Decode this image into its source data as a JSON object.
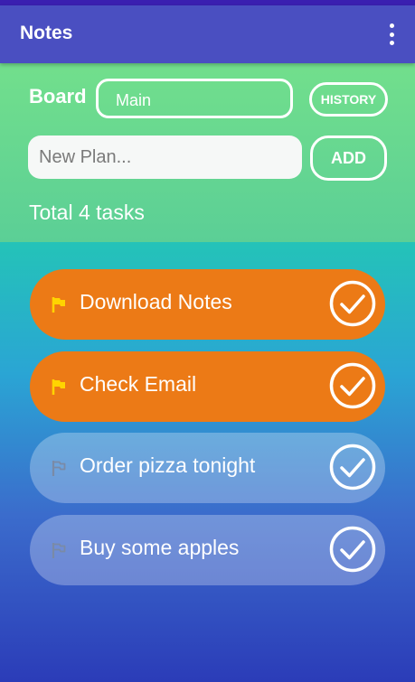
{
  "app": {
    "title": "Notes"
  },
  "board": {
    "label": "Board",
    "selected": "Main",
    "history_label": "HISTORY"
  },
  "plan": {
    "placeholder": "New Plan...",
    "add_label": "ADD"
  },
  "summary": {
    "total_text": "Total 4 tasks"
  },
  "tasks": [
    {
      "label": "Download Notes",
      "important": true
    },
    {
      "label": "Check Email",
      "important": true
    },
    {
      "label": "Order pizza tonight",
      "important": false
    },
    {
      "label": "Buy some apples",
      "important": false
    }
  ],
  "colors": {
    "appbar": "#4a4fc1",
    "panel": "#6ad88f",
    "important_task": "#ec7a16",
    "important_flag": "#ffd400",
    "normal_flag": "#7a8aa6"
  },
  "icons": {
    "menu": "more-vert-icon",
    "flag": "flag-icon",
    "check": "check-circle-icon"
  }
}
